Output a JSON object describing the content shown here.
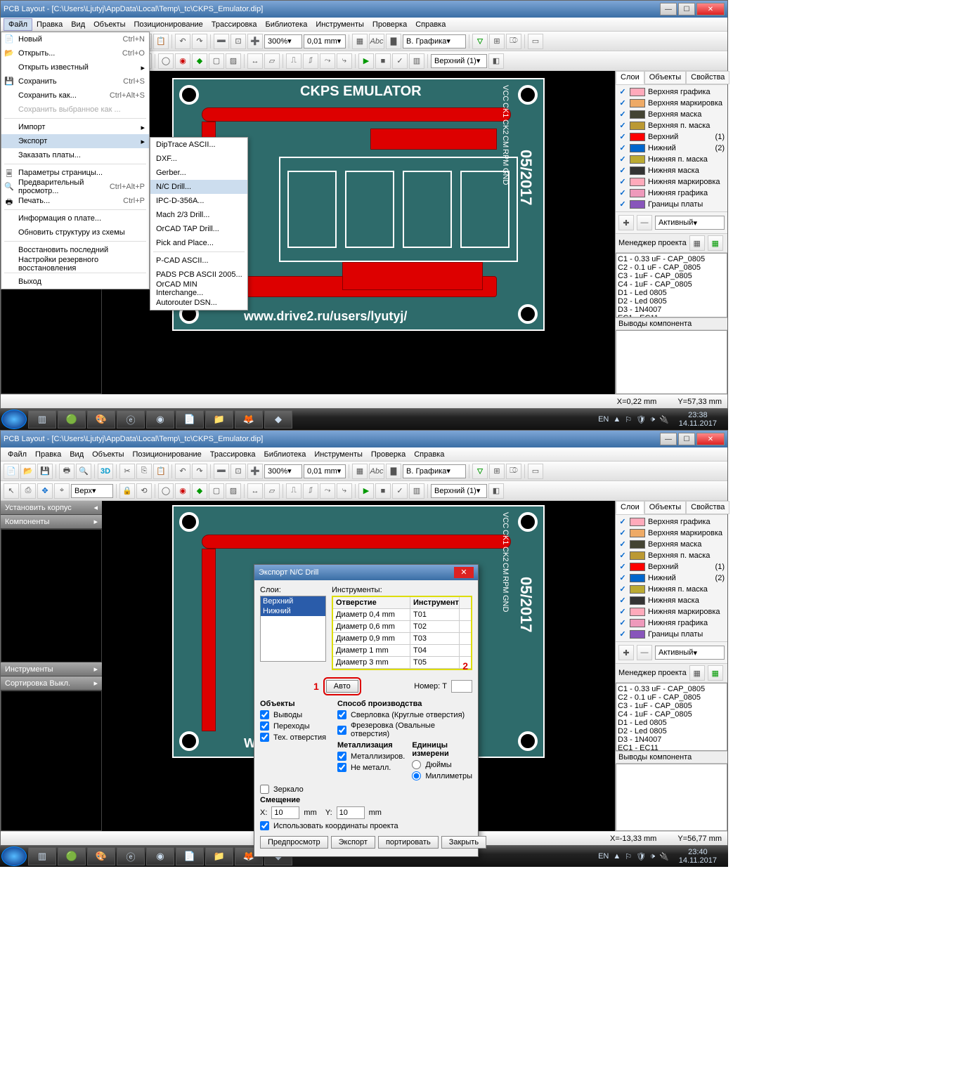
{
  "window_title": "PCB Layout - [C:\\Users\\Ljutyj\\AppData\\Local\\Temp\\_tc\\CKPS_Emulator.dip]",
  "menus": [
    "Файл",
    "Правка",
    "Вид",
    "Объекты",
    "Позиционирование",
    "Трассировка",
    "Библиотека",
    "Инструменты",
    "Проверка",
    "Справка"
  ],
  "toolbar1": {
    "zoom": "300%",
    "grid": "0,01 mm",
    "disp": "В. Графика"
  },
  "toolbar2": {
    "layer_combo_top": "Верх",
    "layer_combo": "Верхний (1)"
  },
  "file_menu": [
    {
      "label": "Новый",
      "sc": "Ctrl+N",
      "ic": "📄"
    },
    {
      "label": "Открыть...",
      "sc": "Ctrl+O",
      "ic": "📂"
    },
    {
      "label": "Открыть известный",
      "sub": true
    },
    {
      "label": "Сохранить",
      "sc": "Ctrl+S",
      "ic": "💾"
    },
    {
      "label": "Сохранить как...",
      "sc": "Ctrl+Alt+S"
    },
    {
      "label": "Сохранить выбранное как ...",
      "dis": true
    },
    {
      "sep": true
    },
    {
      "label": "Импорт",
      "sub": true
    },
    {
      "label": "Экспорт",
      "sub": true,
      "act": true
    },
    {
      "label": "Заказать платы..."
    },
    {
      "sep": true
    },
    {
      "label": "Параметры страницы...",
      "ic": "🗏"
    },
    {
      "label": "Предварительный просмотр...",
      "sc": "Ctrl+Alt+P",
      "ic": "🔍"
    },
    {
      "label": "Печать...",
      "sc": "Ctrl+P",
      "ic": "🖶"
    },
    {
      "sep": true
    },
    {
      "label": "Информация о плате..."
    },
    {
      "label": "Обновить структуру из схемы"
    },
    {
      "sep": true
    },
    {
      "label": "Восстановить последний"
    },
    {
      "label": "Настройки резервного восстановления"
    },
    {
      "sep": true
    },
    {
      "label": "Выход"
    }
  ],
  "export_submenu": [
    "DipTrace ASCII...",
    "DXF...",
    "Gerber...",
    "N/C Drill...",
    "IPC-D-356A...",
    "Mach 2/3 Drill...",
    "OrCAD TAP Drill...",
    "Pick and Place...",
    "",
    "P-CAD ASCII...",
    "PADS PCB ASCII 2005...",
    "OrCAD MIN Interchange...",
    "Autorouter DSN..."
  ],
  "left_panel_top": {
    "sort": "Сортировка Выкл."
  },
  "left_panel_bot": {
    "install": "Установить корпус",
    "comp": "Компоненты",
    "tools": "Инструменты",
    "sort": "Сортировка Выкл."
  },
  "pcb_text": {
    "title": "CKPS EMULATOR",
    "url": "www.drive2.ru/users/lyutyj/",
    "date": "05/2017",
    "pins": [
      "VCC",
      "CK1",
      "CK2",
      "CM",
      "RPM",
      "GND"
    ]
  },
  "right_panel": {
    "tabs": [
      "Слои",
      "Объекты",
      "Свойства"
    ],
    "layers": [
      {
        "c": "#fab",
        "n": "Верхняя графика"
      },
      {
        "c": "#ea6",
        "n": "Верхняя маркировка"
      },
      {
        "c": "#443",
        "n": "Верхняя маска"
      },
      {
        "c": "#b93",
        "n": "Верхняя п. маска"
      },
      {
        "c": "#f00",
        "n": "Верхний",
        "r": "(1)"
      },
      {
        "c": "#06c",
        "n": "Нижний",
        "r": "(2)"
      },
      {
        "c": "#ba3",
        "n": "Нижняя п. маска"
      },
      {
        "c": "#333",
        "n": "Нижняя маска"
      },
      {
        "c": "#fab",
        "n": "Нижняя маркировка"
      },
      {
        "c": "#e9b",
        "n": "Нижняя графика"
      },
      {
        "c": "#85b",
        "n": "Границы платы"
      }
    ],
    "layer_mode": "Активный",
    "pm_title": "Менеджер проекта",
    "pm_items": [
      "C1 - 0.33 uF - CAP_0805",
      "C2 - 0.1 uF - CAP_0805",
      "C3 - 1uF - CAP_0805",
      "C4 - 1uF - CAP_0805",
      "D1 - Led 0805",
      "D2 - Led 0805",
      "D3 - 1N4007",
      "EC1 - EC11"
    ],
    "pins_title": "Выводы компонента"
  },
  "status1": {
    "x": "X=0,22 mm",
    "y": "Y=57,33 mm"
  },
  "status2": {
    "x": "X=-13,33 mm",
    "y": "Y=56,77 mm"
  },
  "taskbar": {
    "lang": "EN",
    "time1": "23:38",
    "date1": "14.11.2017",
    "time2": "23:40",
    "date2": "14.11.2017"
  },
  "dialog": {
    "title": "Экспорт N/C Drill",
    "layers_lbl": "Слои:",
    "layers": [
      "Верхний",
      "Нижний"
    ],
    "tools_lbl": "Инструменты:",
    "table_h": [
      "Отверстие",
      "Инструмент"
    ],
    "table": [
      [
        "Диаметр 0,4 mm",
        "T01"
      ],
      [
        "Диаметр 0,6 mm",
        "T02"
      ],
      [
        "Диаметр 0,9 mm",
        "T03"
      ],
      [
        "Диаметр 1 mm",
        "T04"
      ],
      [
        "Диаметр 3 mm",
        "T05"
      ]
    ],
    "auto_btn": "Авто",
    "num_lbl": "Номер: T",
    "objects_lbl": "Объекты",
    "o1": "Выводы",
    "o2": "Переходы",
    "o3": "Тех. отверстия",
    "prod_lbl": "Способ производства",
    "p1": "Сверловка (Круглые отверстия)",
    "p2": "Фрезеровка (Овальные отверстия)",
    "metal_lbl": "Металлизация",
    "m1": "Металлизиров.",
    "m2": "Не металл.",
    "units_lbl": "Единицы измерени",
    "u1": "Дюймы",
    "u2": "Миллиметры",
    "mirror": "Зеркало",
    "offset_lbl": "Смещение",
    "x": "10",
    "y": "10",
    "mm": "mm",
    "coords": "Использовать координаты проекта",
    "btns": [
      "Предпросмотр",
      "Экспорт",
      "портировать",
      "Закрыть"
    ],
    "ann1": "1",
    "ann2": "2"
  }
}
